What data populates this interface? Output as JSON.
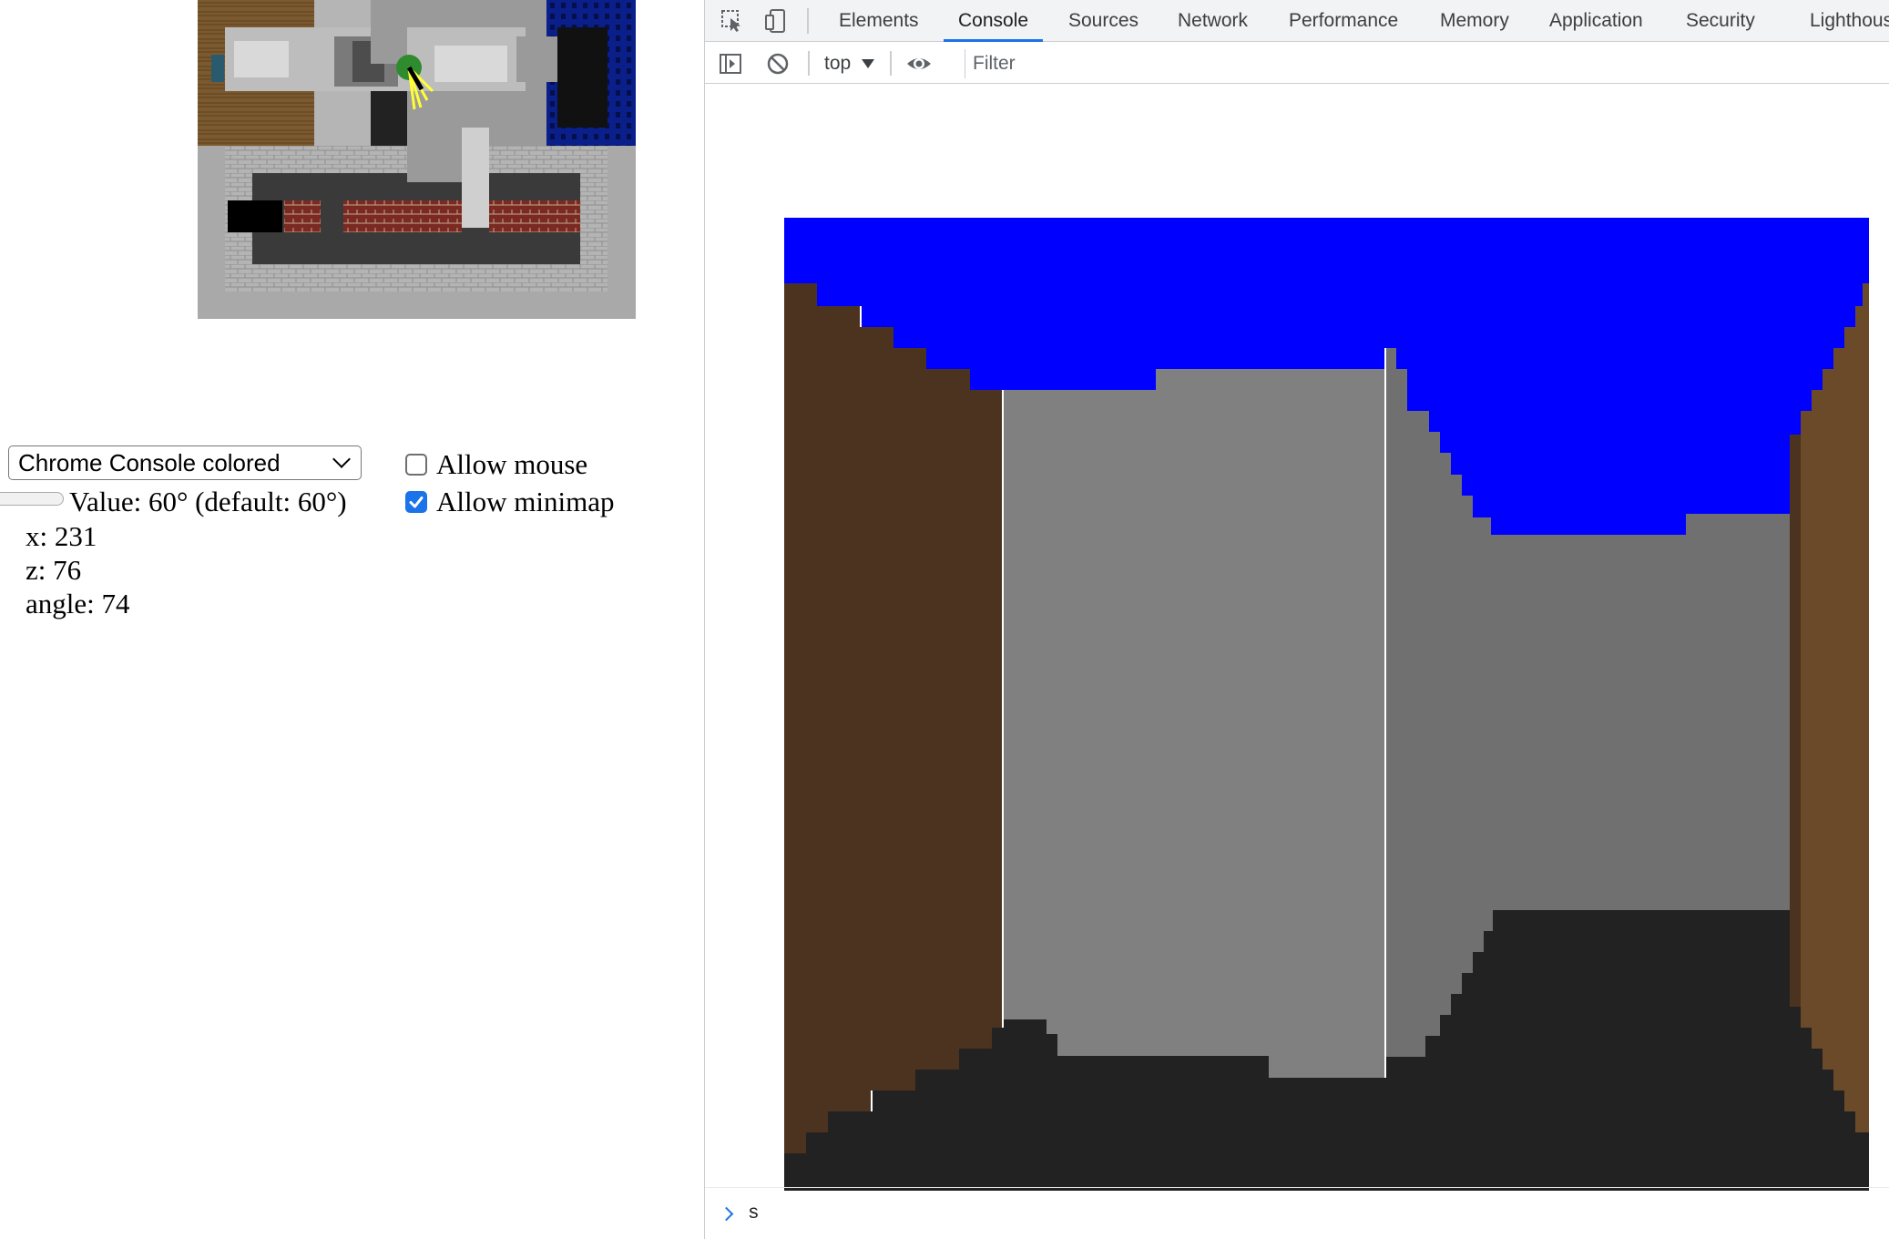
{
  "page": {
    "render_mode": {
      "selected": "Chrome Console colored"
    },
    "allow_mouse": {
      "label": "Allow mouse",
      "checked": false
    },
    "allow_minimap": {
      "label": "Allow minimap",
      "checked": true
    },
    "fov": {
      "value_text": "Value: 60° (default: 60°)",
      "value_deg": 60,
      "default_deg": 60
    },
    "player": {
      "x_text": "x: 231",
      "z_text": "z: 76",
      "angle_text": "angle: 74"
    }
  },
  "devtools": {
    "tabs": [
      {
        "label": "Elements",
        "active": false
      },
      {
        "label": "Console",
        "active": true
      },
      {
        "label": "Sources",
        "active": false
      },
      {
        "label": "Network",
        "active": false
      },
      {
        "label": "Performance",
        "active": false
      },
      {
        "label": "Memory",
        "active": false
      },
      {
        "label": "Application",
        "active": false
      },
      {
        "label": "Security",
        "active": false
      },
      {
        "label": "Lighthous",
        "active": false
      }
    ],
    "toolbar": {
      "context": "top",
      "filter_placeholder": "Filter"
    },
    "prompt": {
      "command": "s"
    }
  },
  "colors": {
    "accent": "#1a73e8",
    "sky": "#0000ff",
    "floor": "#222222",
    "wall_brown_dark": "#4c3320",
    "wall_brown_light": "#6b4a2a",
    "wall_gray_light": "#808080",
    "wall_gray_dark": "#707070"
  },
  "icons": {
    "inspect": "inspect-element-icon",
    "device": "device-toolbar-icon",
    "sidebar": "console-sidebar-icon",
    "clear": "clear-console-icon",
    "eye": "live-expression-eye-icon",
    "prompt": "console-prompt-chevron-icon",
    "select_chevron": "chevron-down-icon",
    "checkmark": "checkmark-icon"
  }
}
